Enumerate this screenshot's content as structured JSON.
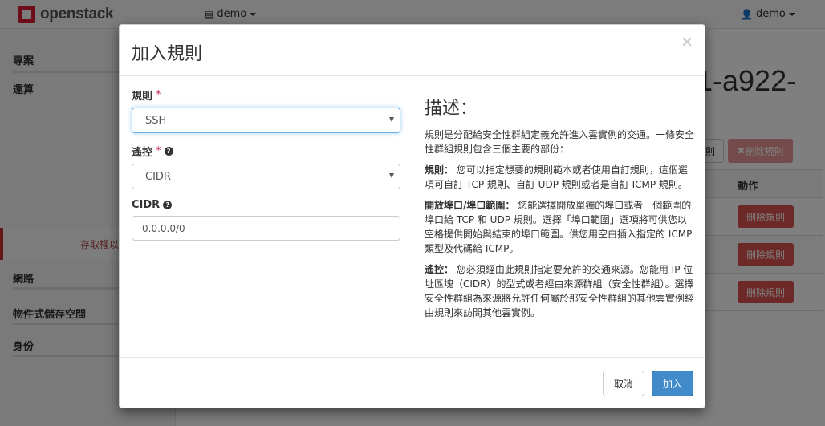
{
  "app": {
    "brand": "openstack",
    "project_menu": "demo",
    "user_menu": "demo"
  },
  "sidebar": {
    "items": [
      {
        "label": "專案"
      },
      {
        "label": "運算"
      },
      {
        "label": "存取權以"
      },
      {
        "label": "網路"
      },
      {
        "label": "物件式儲存空間"
      },
      {
        "label": "身份"
      }
    ]
  },
  "background": {
    "title_fragment": "1-a922-",
    "toolbar_outline_label": "則",
    "toolbar_delete_label": "刪除規則",
    "table_header": "動作",
    "row_delete_label": "刪除規則"
  },
  "modal": {
    "title": "加入規則",
    "close_symbol": "×",
    "fields": {
      "rule": {
        "label": "規則",
        "required_mark": "*",
        "value": "SSH"
      },
      "remote": {
        "label": "遙控",
        "required_mark": "*",
        "value": "CIDR"
      },
      "cidr": {
        "label": "CIDR",
        "value": "0.0.0.0/0"
      }
    },
    "description": {
      "title": "描述：",
      "intro": "規則是分配給安全性群組定義允許進入雲實例的交通。一條安全性群組規則包含三個主要的部份：",
      "rule_term": "規則：",
      "rule_text": "您可以指定想要的規則範本或者使用自訂規則，這個選項可自訂 TCP 規則、自訂 UDP 規則或者是自訂 ICMP 規則。",
      "port_term": "開放埠口/埠口範圍：",
      "port_text": "您能選擇開放單獨的埠口或者一個範圍的埠口給 TCP 和 UDP 規則。選擇「埠口範圍」選項將可供您以空格提供開始與結束的埠口範圍。供您用空白插入指定的 ICMP 類型及代碼給 ICMP。",
      "remote_term": "遙控：",
      "remote_text": "您必須經由此規則指定要允許的交通來源。您能用 IP 位址區塊（CIDR）的型式或者經由來源群組（安全性群組）。選擇安全性群組為來源將允許任何屬於那安全性群組的其他雲實例經由規則來訪問其他雲實例。"
    },
    "buttons": {
      "cancel": "取消",
      "add": "加入"
    }
  },
  "colors": {
    "primary": "#428bca",
    "danger": "#d9534f",
    "brand": "#da1a32"
  }
}
